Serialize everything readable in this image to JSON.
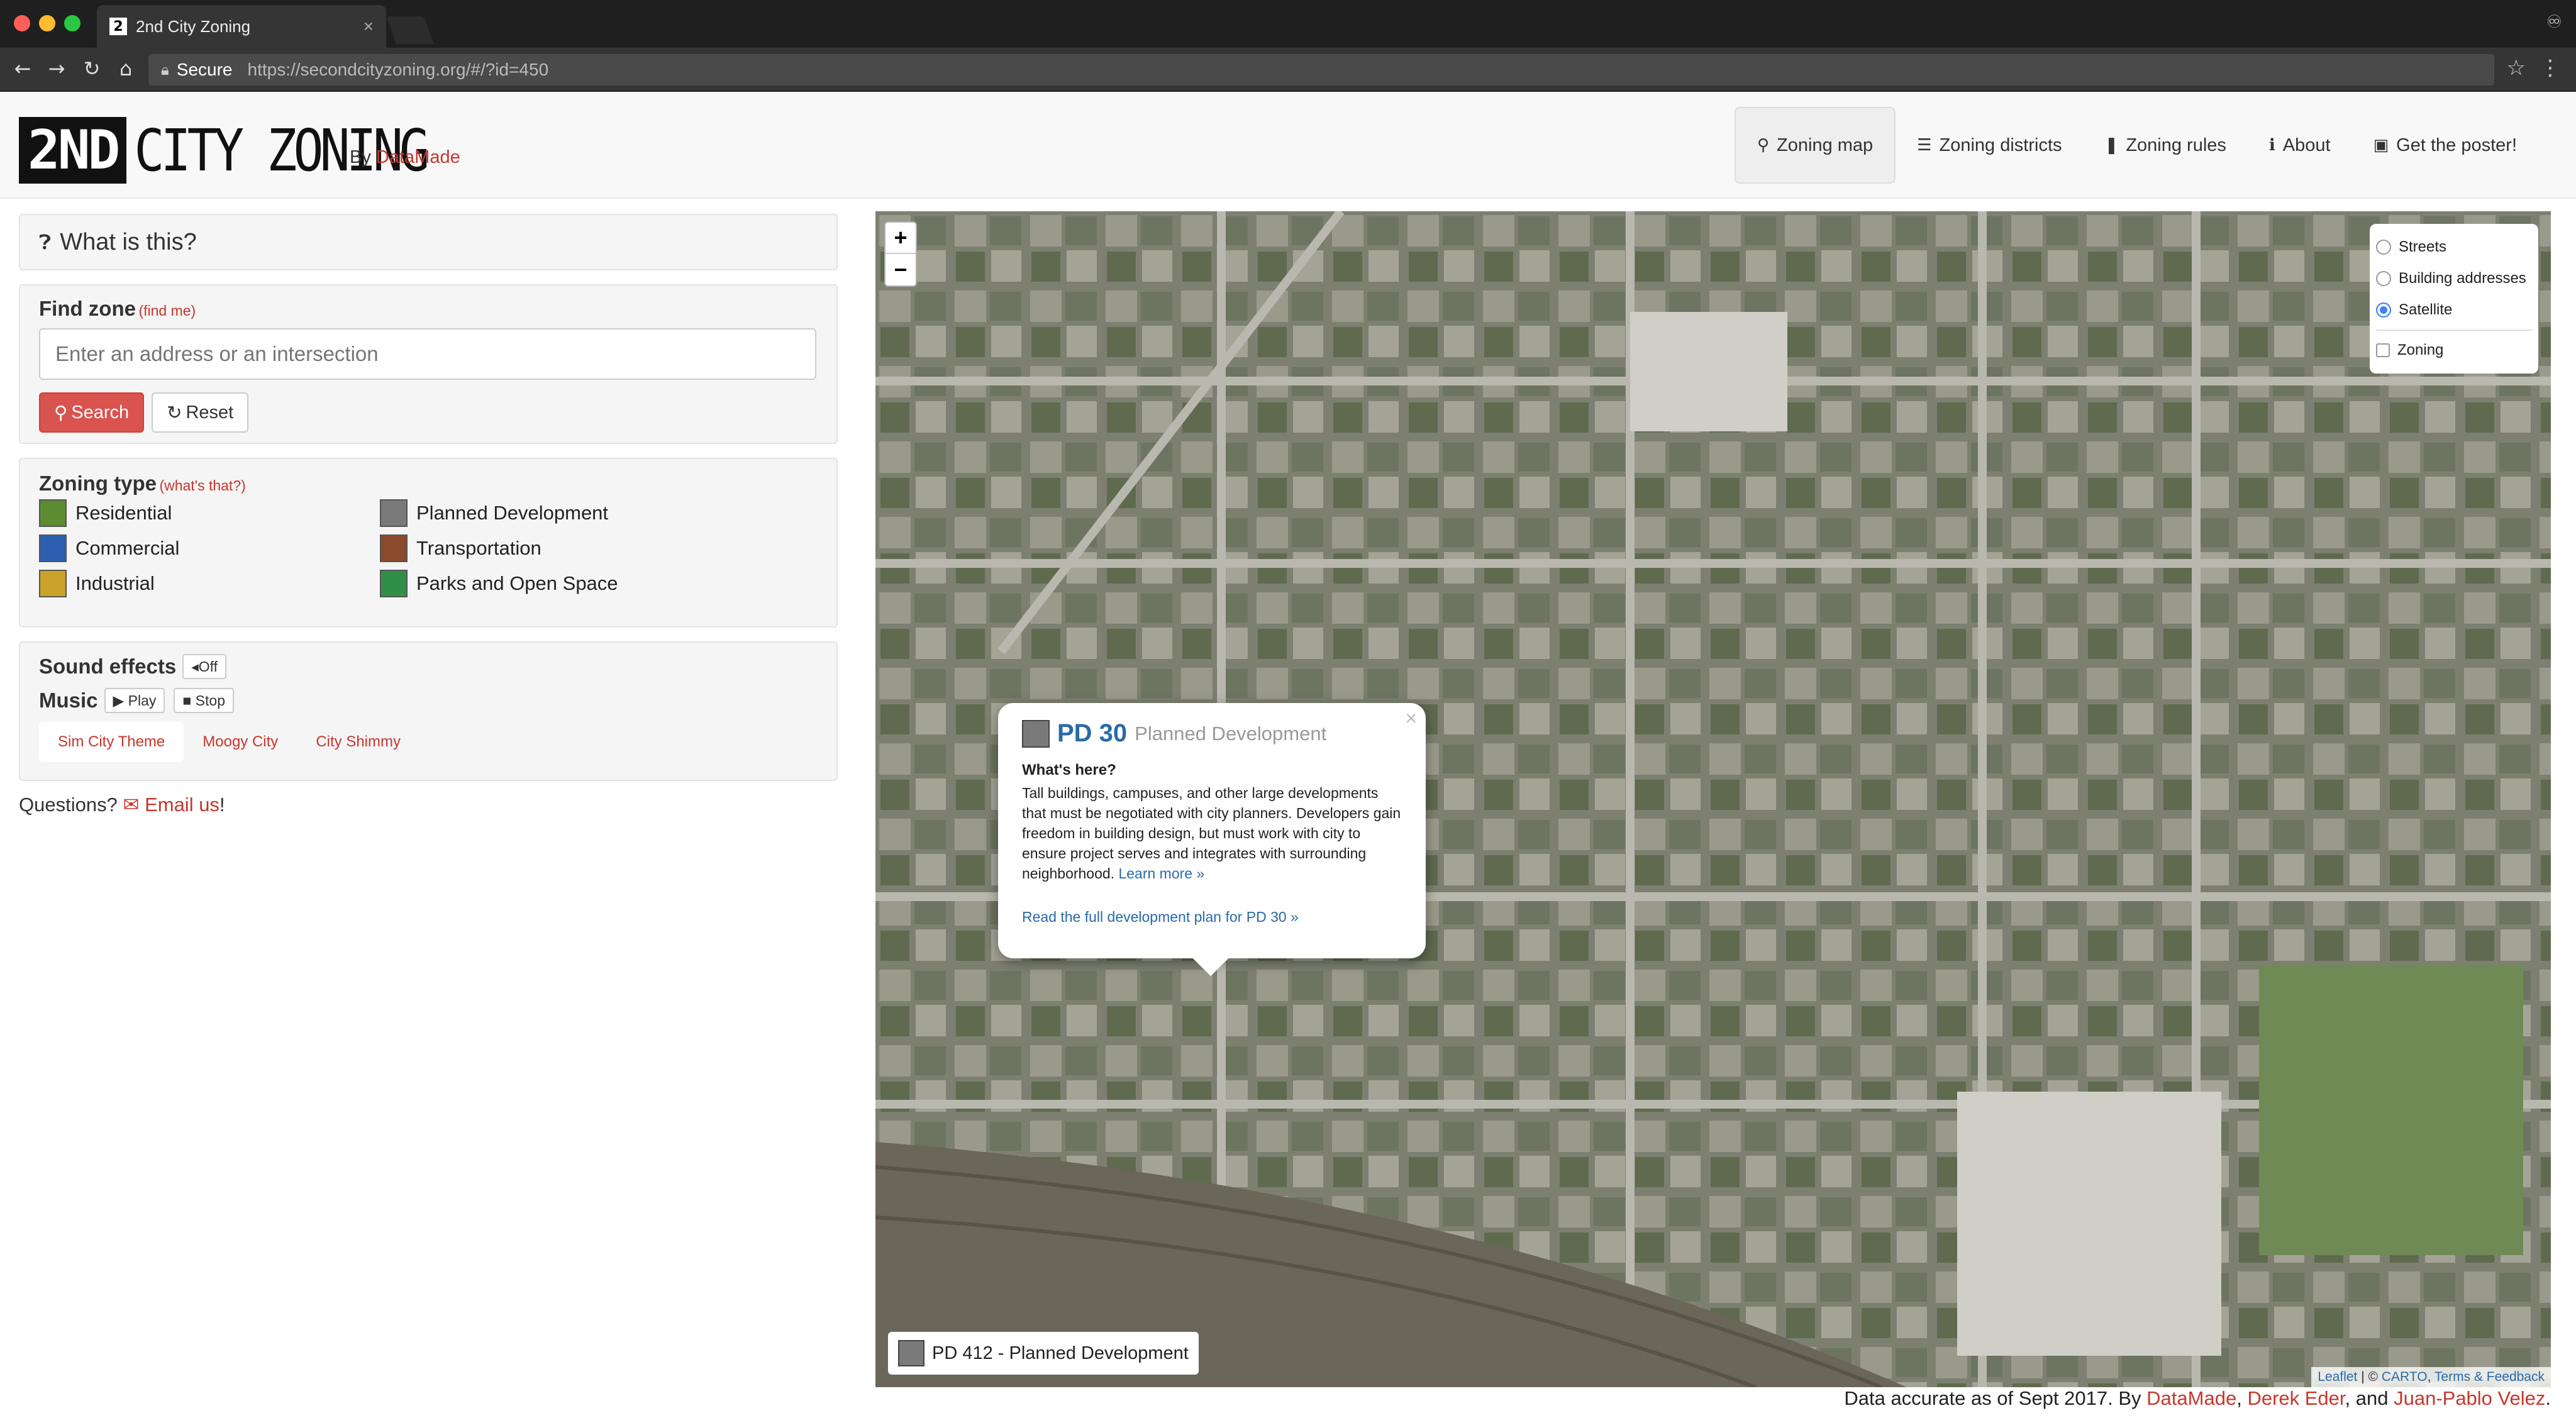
{
  "browser": {
    "tab_title": "2nd City Zoning",
    "tab_favicon": "2",
    "tab_close": "×",
    "secure_label": "Secure",
    "url": "https://secondcityzoning.org/#/?id=450",
    "back": "←",
    "forward": "→",
    "reload": "↻",
    "home": "⌂",
    "star": "☆",
    "menu": "⋮",
    "profile": "♾"
  },
  "header": {
    "logo_block": "2ND",
    "logo_text": "CITY ZONING",
    "by_label": "By",
    "by_link": "DataMade",
    "nav": [
      {
        "label": "Zoning map",
        "icon": "⚲"
      },
      {
        "label": "Zoning districts",
        "icon": "☰"
      },
      {
        "label": "Zoning rules",
        "icon": "❚"
      },
      {
        "label": "About",
        "icon": "ℹ"
      },
      {
        "label": "Get the poster!",
        "icon": "▣"
      }
    ]
  },
  "sidebar": {
    "what_is_this": "What is this?",
    "find_zone": {
      "title": "Find zone",
      "find_me": "(find me)",
      "placeholder": "Enter an address or an intersection",
      "search_label": "Search",
      "reset_label": "Reset"
    },
    "zoning_type": {
      "title": "Zoning type",
      "whats_that": "(what's that?)",
      "items": [
        {
          "label": "Residential",
          "color": "#5b8c32"
        },
        {
          "label": "Planned Development",
          "color": "#7a7a7a"
        },
        {
          "label": "Commercial",
          "color": "#2d5fb0"
        },
        {
          "label": "Transportation",
          "color": "#8b4a2b"
        },
        {
          "label": "Industrial",
          "color": "#c9a227"
        },
        {
          "label": "Parks and Open Space",
          "color": "#2f8f46"
        }
      ]
    },
    "sound": {
      "sound_title": "Sound effects",
      "sound_btn": "Off",
      "music_title": "Music",
      "play_label": "Play",
      "stop_label": "Stop",
      "tracks": [
        "Sim City Theme",
        "Moogy City",
        "City Shimmy"
      ]
    },
    "questions": {
      "label": "Questions?",
      "email_link": "Email us",
      "suffix": "!"
    }
  },
  "map": {
    "zoom_in": "+",
    "zoom_out": "−",
    "layers": {
      "base": [
        {
          "label": "Streets",
          "selected": false
        },
        {
          "label": "Building addresses",
          "selected": false
        },
        {
          "label": "Satellite",
          "selected": true
        }
      ],
      "overlay": [
        {
          "label": "Zoning",
          "checked": false
        }
      ]
    },
    "popup": {
      "code": "PD 30",
      "type": "Planned Development",
      "close": "×",
      "whats_here": "What's here?",
      "description": "Tall buildings, campuses, and other large developments that must be negotiated with city planners. Developers gain freedom in building design, but must work with city to ensure project serves and integrates with surrounding neighborhood.",
      "learn_more": "Learn more »",
      "full_plan": "Read the full development plan for PD 30 »"
    },
    "infobox": "PD 412 - Planned Development",
    "attribution": {
      "leaflet": "Leaflet",
      "sep": "| ©",
      "carto": "CARTO",
      "comma": ",",
      "terms": "Terms & Feedback"
    }
  },
  "footer": {
    "prefix": "Data accurate as of Sept 2017. By",
    "a1": "DataMade",
    "c1": ",",
    "a2": "Derek Eder",
    "c2": ", and",
    "a3": "Juan-Pablo Velez",
    "end": "."
  }
}
